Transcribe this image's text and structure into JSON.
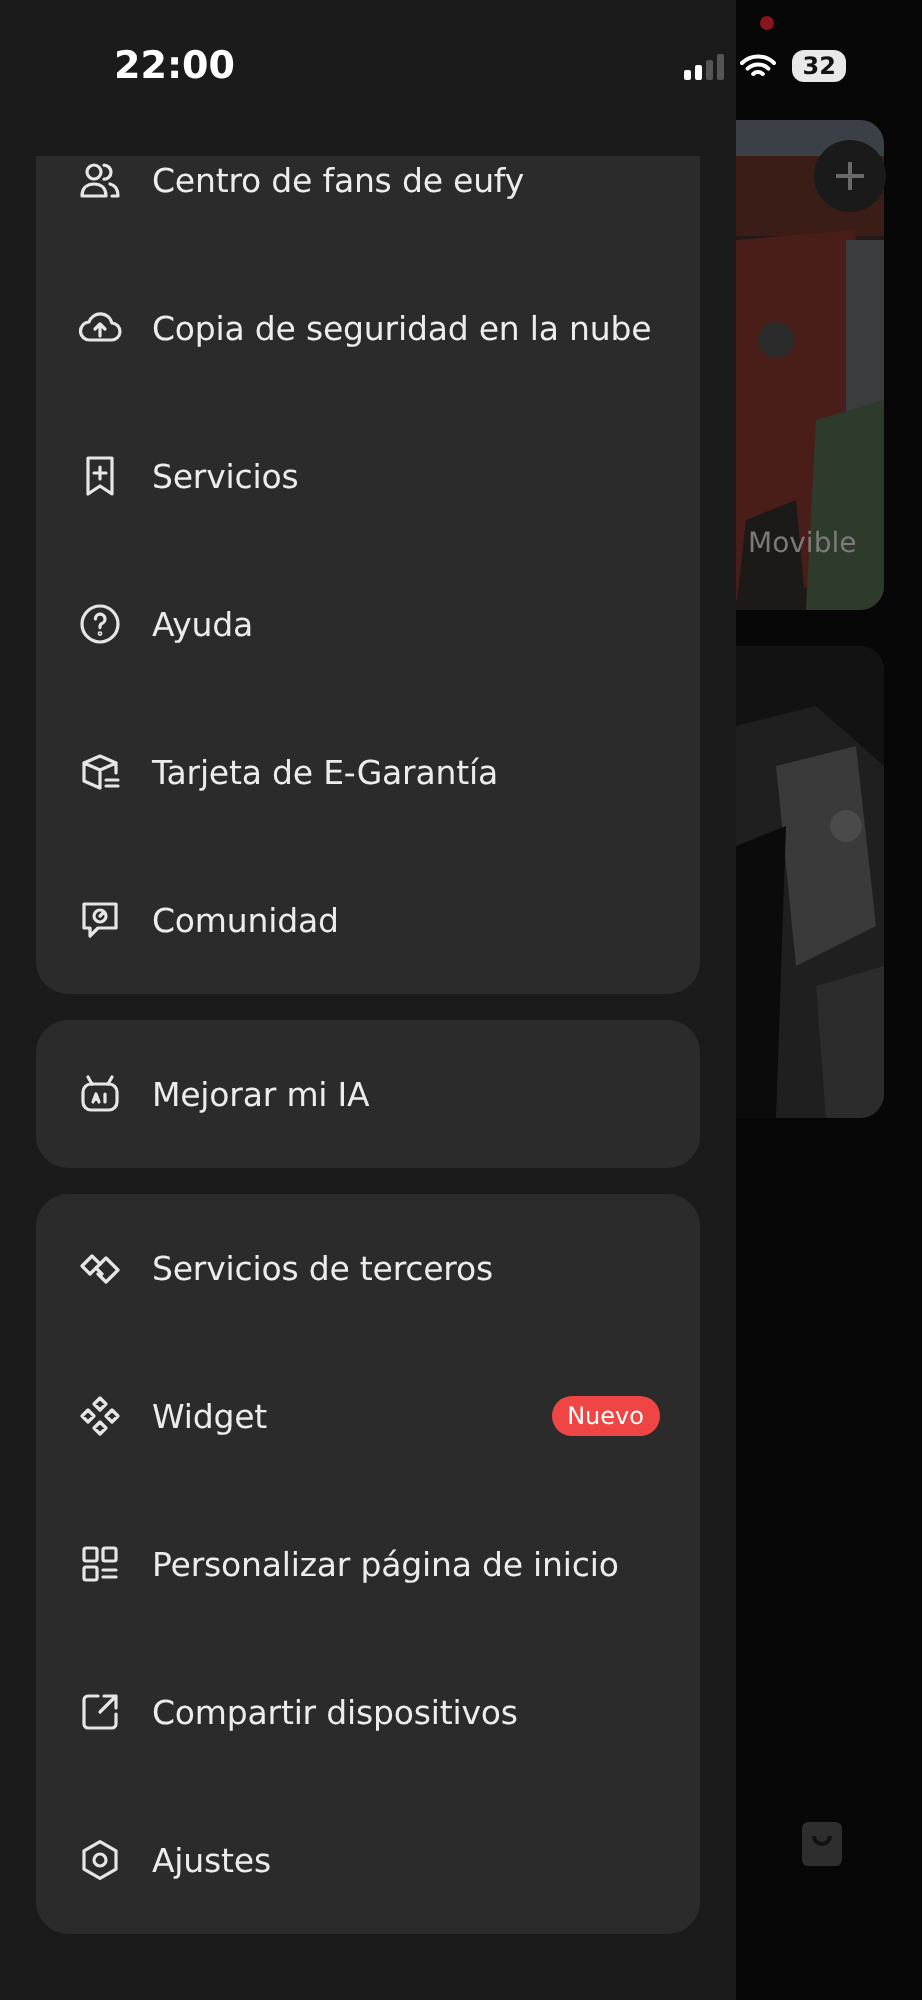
{
  "status_bar": {
    "time": "22:00",
    "battery": "32"
  },
  "menu_groups": [
    {
      "items": [
        {
          "label": "Centro de fans de eufy"
        },
        {
          "label": "Copia de seguridad en la nube"
        },
        {
          "label": "Servicios"
        },
        {
          "label": "Ayuda"
        },
        {
          "label": "Tarjeta de E-Garantía"
        },
        {
          "label": "Comunidad"
        }
      ]
    },
    {
      "items": [
        {
          "label": "Mejorar mi IA"
        }
      ]
    },
    {
      "items": [
        {
          "label": "Servicios de terceros"
        },
        {
          "label": "Widget",
          "badge": "Nuevo"
        },
        {
          "label": "Personalizar página de inicio"
        },
        {
          "label": "Compartir dispositivos"
        },
        {
          "label": "Ajustes"
        }
      ]
    }
  ],
  "background": {
    "camera_label": "Movible"
  }
}
